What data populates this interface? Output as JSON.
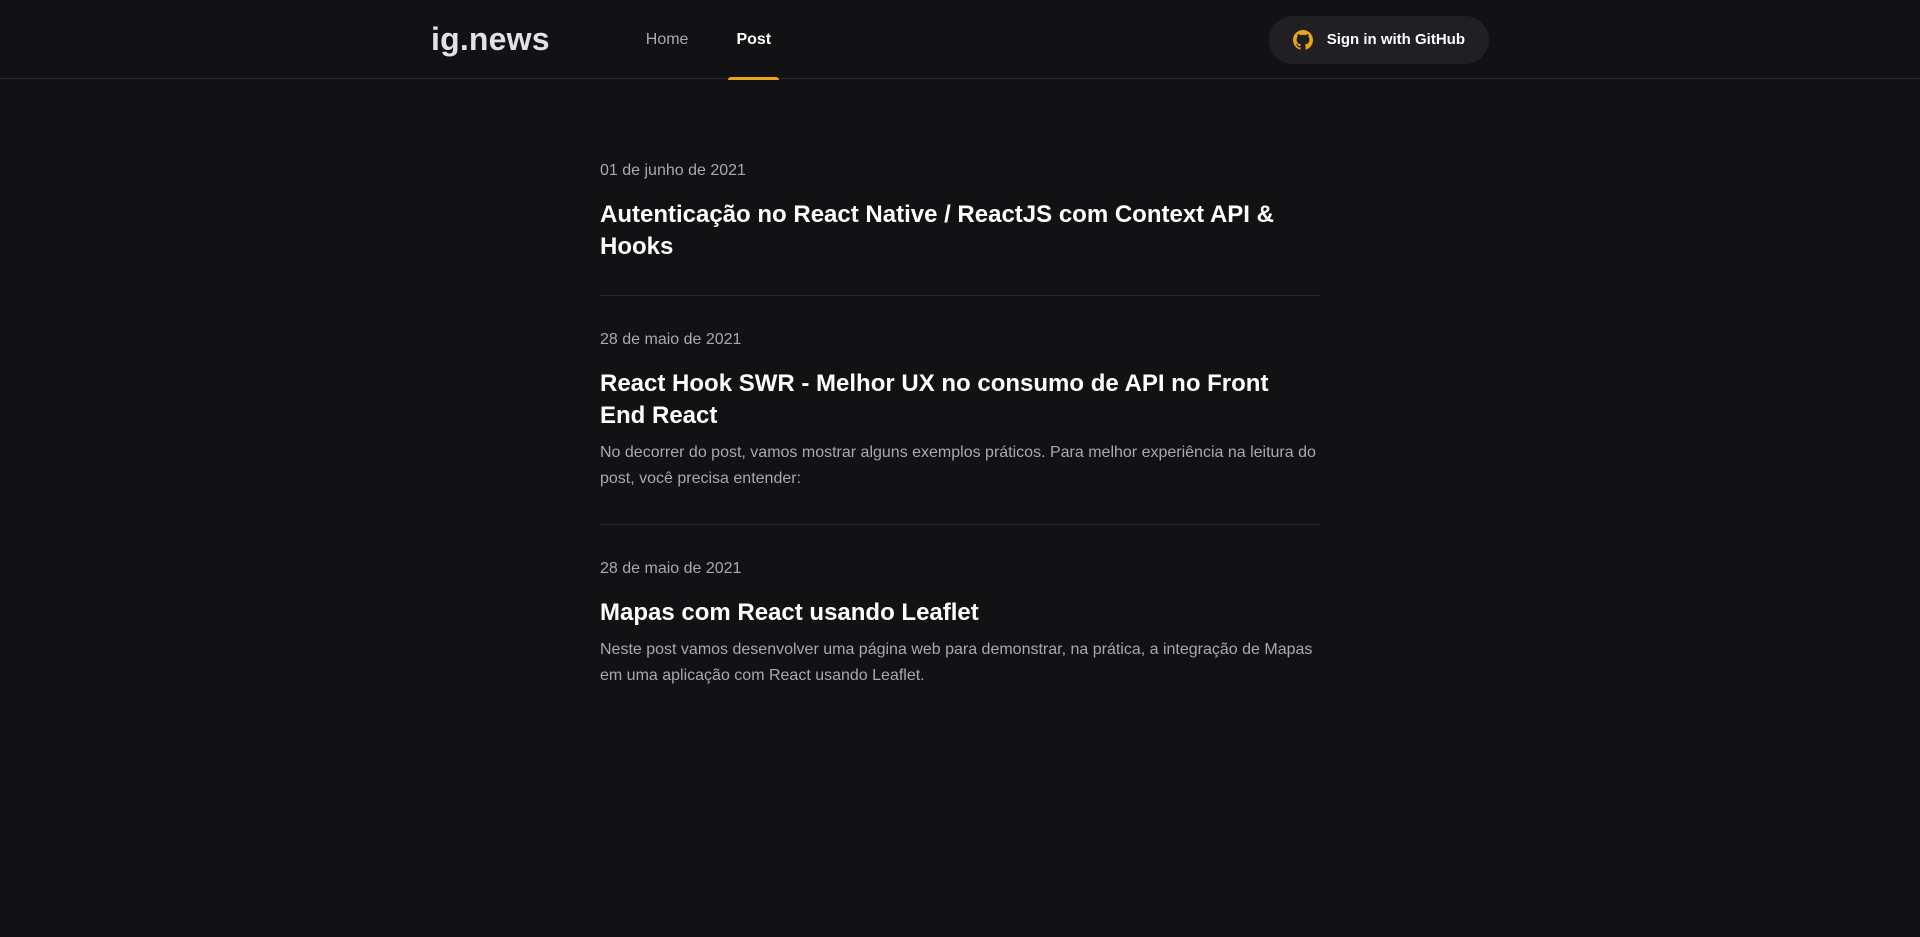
{
  "header": {
    "logo": "ig.news",
    "nav": [
      {
        "label": "Home",
        "active": false
      },
      {
        "label": "Post",
        "active": true
      }
    ],
    "signin_label": "Sign in with GitHub",
    "signin_icon": "github-icon",
    "colors": {
      "accent": "#eba417",
      "background": "#121214",
      "button_bg": "#202024"
    }
  },
  "posts": [
    {
      "date": "01 de junho de 2021",
      "title": "Autenticação no React Native / ReactJS com Context API & Hooks",
      "excerpt": ""
    },
    {
      "date": "28 de maio de 2021",
      "title": "React Hook SWR - Melhor UX no consumo de API no Front End React",
      "excerpt": "No decorrer do post, vamos mostrar alguns exemplos práticos. Para melhor experiência na leitura do post, você precisa entender:"
    },
    {
      "date": "28 de maio de 2021",
      "title": "Mapas com React usando Leaflet",
      "excerpt": "Neste post vamos desenvolver uma página web para demonstrar, na prática, a integração de Mapas em uma aplicação com React usando Leaflet."
    }
  ]
}
